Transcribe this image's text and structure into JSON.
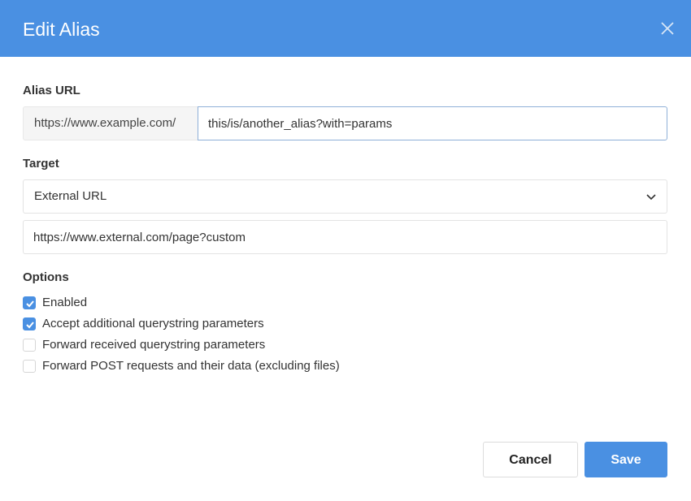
{
  "dialog": {
    "title": "Edit Alias",
    "close_icon": "close-icon"
  },
  "alias_url": {
    "label": "Alias URL",
    "prefix": "https://www.example.com/",
    "value": "this/is/another_alias?with=params"
  },
  "target": {
    "label": "Target",
    "selected": "External URL",
    "chevron_icon": "chevron-down-icon",
    "url_value": "https://www.external.com/page?custom"
  },
  "options": {
    "label": "Options",
    "items": [
      {
        "label": "Enabled",
        "checked": true
      },
      {
        "label": "Accept additional querystring parameters",
        "checked": true
      },
      {
        "label": "Forward received querystring parameters",
        "checked": false
      },
      {
        "label": "Forward POST requests and their data (excluding files)",
        "checked": false
      }
    ]
  },
  "buttons": {
    "cancel": "Cancel",
    "save": "Save"
  },
  "colors": {
    "accent": "#4a90e2",
    "header_text": "#ffffff"
  }
}
